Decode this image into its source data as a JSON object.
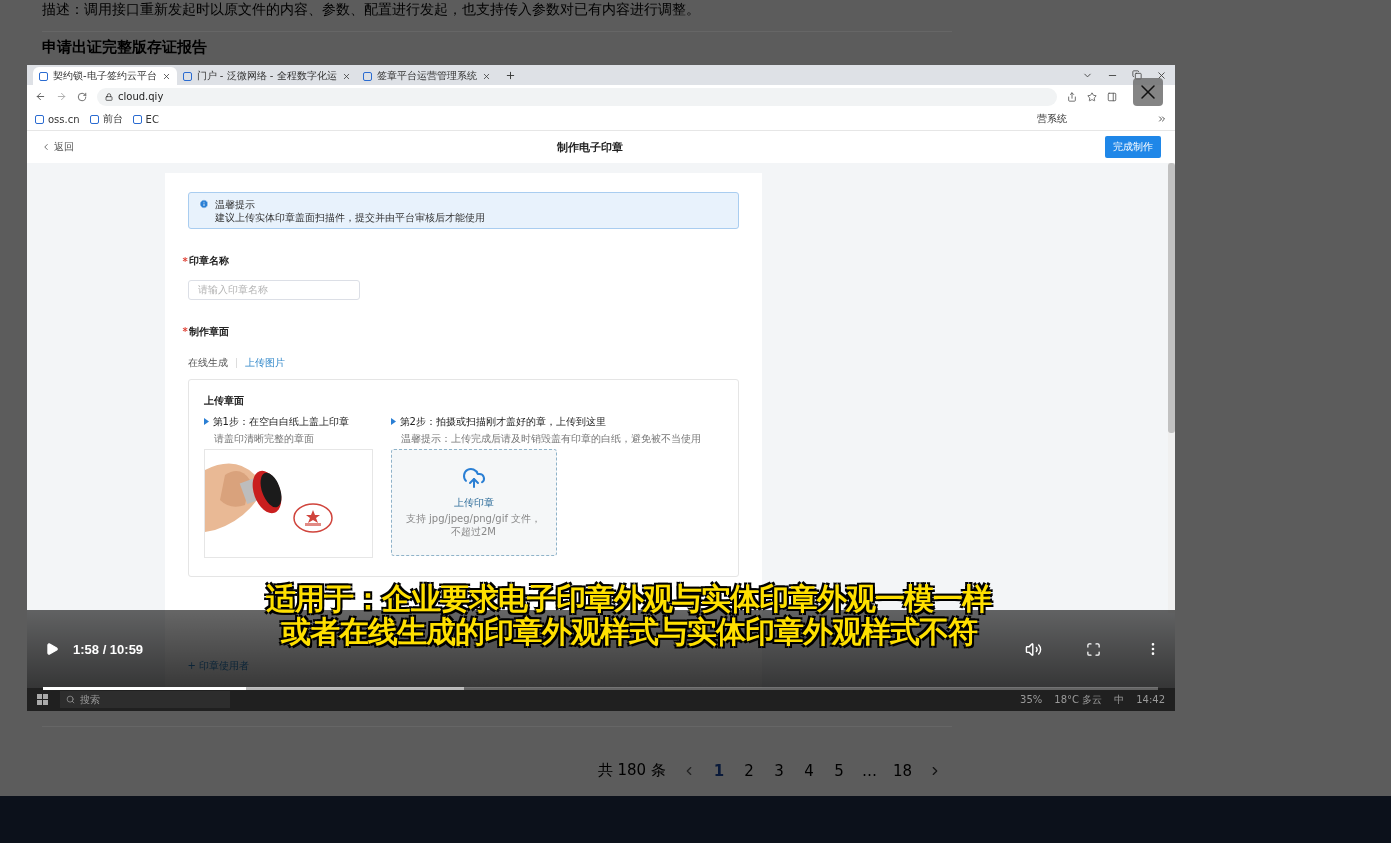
{
  "page": {
    "description": "描述：调用接口重新发起时以原文件的内容、参数、配置进行发起，也支持传入参数对已有内容进行调整。",
    "heading": "申请出证完整版存证报告"
  },
  "video": {
    "browser": {
      "tabs": [
        {
          "title": "契约锁-电子签约云平台",
          "selected": true
        },
        {
          "title": "门户 - 泛微网络 - 全程数字化运",
          "selected": false
        },
        {
          "title": "签章平台运营管理系统",
          "selected": false
        }
      ],
      "url": "cloud.qiy",
      "bookmarks": [
        {
          "label": "oss.cn"
        },
        {
          "label": "前台"
        },
        {
          "label": "EC"
        }
      ],
      "bookmark_cut": "营系统"
    },
    "app": {
      "back": "返回",
      "title": "制作电子印章",
      "finish_button": "完成制作",
      "notice": {
        "title": "温馨提示",
        "text": "建议上传实体印章盖面扫描件，提交并由平台审核后才能使用"
      },
      "name_field": {
        "label": "印章名称",
        "required_mark": "*",
        "placeholder": "请输入印章名称"
      },
      "face": {
        "label": "制作章面",
        "required_mark": "*",
        "modes": [
          {
            "label": "在线生成",
            "selected": false
          },
          {
            "label": "上传图片",
            "selected": true
          }
        ],
        "upload": {
          "title": "上传章面",
          "steps": [
            {
              "title": "第1步：在空白白纸上盖上印章",
              "hint": "请盖印清晰完整的章面"
            },
            {
              "title": "第2步：拍摄或扫描刚才盖好的章，上传到这里",
              "hint": "温馨提示：上传完成后请及时销毁盖有印章的白纸，避免被不当使用"
            }
          ],
          "dropzone": {
            "title": "上传印章",
            "hint": "支持 jpg/jpeg/png/gif 文件，不超过2M"
          }
        }
      },
      "add_user": "+ 印章使用者"
    },
    "taskbar": {
      "search": "搜索",
      "items": [
        "35%",
        "18°C 多云",
        "中",
        "14:42"
      ]
    },
    "subtitles": [
      "适用于：企业要求电子印章外观与实体印章外观一模一样",
      "或者在线生成的印章外观样式与实体印章外观样式不符"
    ],
    "player": {
      "time": "1:58 / 10:59",
      "progress": {
        "level": 0.182
      },
      "buffer": {
        "level": 0.378
      }
    }
  },
  "pagination": {
    "total": "共 180 条",
    "pages": [
      {
        "label": "1",
        "selected": true
      },
      {
        "label": "2",
        "selected": false
      },
      {
        "label": "3",
        "selected": false
      },
      {
        "label": "4",
        "selected": false
      },
      {
        "label": "5",
        "selected": false
      },
      {
        "label": "…",
        "selected": false
      },
      {
        "label": "18",
        "selected": false
      }
    ]
  }
}
